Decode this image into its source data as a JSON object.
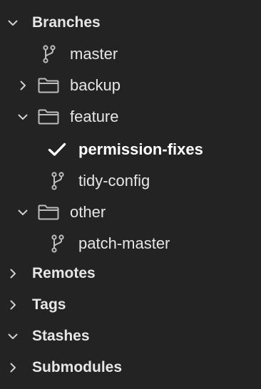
{
  "sidebar": {
    "branches": {
      "label": "Branches",
      "expanded": true,
      "items": [
        {
          "label": "master",
          "icon": "branch-icon"
        },
        {
          "label": "backup",
          "icon": "folder-icon",
          "expanded": false
        },
        {
          "label": "feature",
          "icon": "folder-icon",
          "expanded": true,
          "children": [
            {
              "label": "permission-fixes",
              "icon": "checkmark-icon",
              "current": true
            },
            {
              "label": "tidy-config",
              "icon": "branch-icon"
            }
          ]
        },
        {
          "label": "other",
          "icon": "folder-icon",
          "expanded": true,
          "children": [
            {
              "label": "patch-master",
              "icon": "branch-icon"
            }
          ]
        }
      ]
    },
    "remotes": {
      "label": "Remotes",
      "expanded": false
    },
    "tags": {
      "label": "Tags",
      "expanded": false
    },
    "stashes": {
      "label": "Stashes",
      "expanded": true
    },
    "submodules": {
      "label": "Submodules",
      "expanded": false
    }
  }
}
